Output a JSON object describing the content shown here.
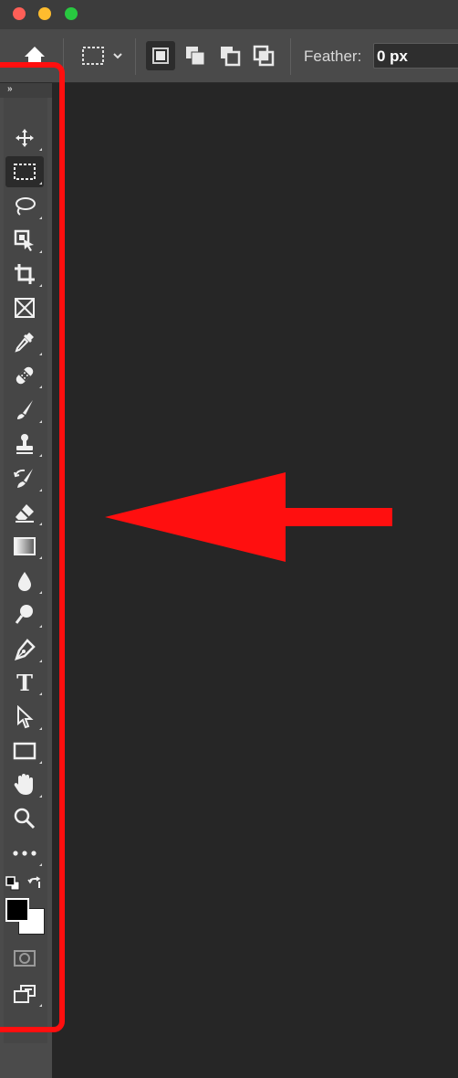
{
  "window": {
    "controls": [
      "close",
      "minimize",
      "zoom"
    ]
  },
  "options_bar": {
    "home_icon": "home-icon",
    "marquee_preset_icon": "rect-marquee-icon",
    "selection_modes": [
      {
        "name": "new-selection-icon",
        "selected": true
      },
      {
        "name": "add-to-selection-icon",
        "selected": false
      },
      {
        "name": "subtract-from-selection-icon",
        "selected": false
      },
      {
        "name": "intersect-with-selection-icon",
        "selected": false
      }
    ],
    "feather_label": "Feather:",
    "feather_value": "0 px"
  },
  "toolbar": {
    "grip_label": "»",
    "tools": [
      "move-tool-icon",
      "rectangular-marquee-tool-icon",
      "lasso-tool-icon",
      "object-selection-tool-icon",
      "crop-tool-icon",
      "frame-tool-icon",
      "eyedropper-tool-icon",
      "spot-healing-brush-icon",
      "brush-tool-icon",
      "clone-stamp-tool-icon",
      "history-brush-icon",
      "eraser-tool-icon",
      "gradient-tool-icon",
      "blur-tool-icon",
      "dodge-tool-icon",
      "pen-tool-icon",
      "type-tool-icon",
      "path-selection-tool-icon",
      "rectangle-tool-icon",
      "hand-tool-icon",
      "zoom-tool-icon",
      "edit-toolbar-icon"
    ],
    "type_tool_glyph": "T",
    "foreground_color": "#000000",
    "background_color": "#ffffff"
  },
  "annotation": {
    "highlight_color": "#ff0f0f"
  }
}
